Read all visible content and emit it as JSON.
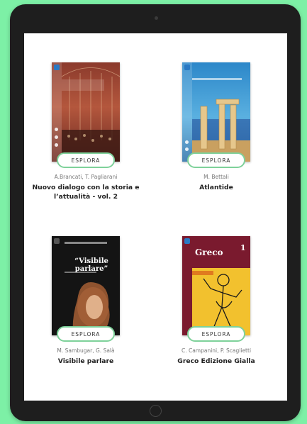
{
  "books": [
    {
      "authors": "A.Brancati, T. Pagliarani",
      "title": "Nuovo dialogo con la storia e l’attualità - vol. 2",
      "button": "ESPLORA",
      "colors": {
        "cover": "#8a3b2e",
        "accent": "#c85a3a"
      }
    },
    {
      "authors": "M. Bettali",
      "title": "Atlantide",
      "button": "ESPLORA",
      "colors": {
        "cover": "#1e6fb5",
        "accent": "#d8a24a"
      }
    },
    {
      "authors": "M. Sambugar, G. Salà",
      "title": "Visibile parlare",
      "button": "ESPLORA",
      "cover_heading": "“Visibile parlare”",
      "colors": {
        "cover": "#151515",
        "accent": "#b5683a"
      }
    },
    {
      "authors": "C. Campanini, P. Scaglietti",
      "title": "Greco Edizione Gialla",
      "button": "ESPLORA",
      "cover_heading": "Greco",
      "cover_number": "1",
      "colors": {
        "cover": "#7a1a2e",
        "accent": "#f2c12e"
      }
    }
  ],
  "theme": {
    "background": "#7df0a6",
    "button_border": "#7ed19a"
  }
}
